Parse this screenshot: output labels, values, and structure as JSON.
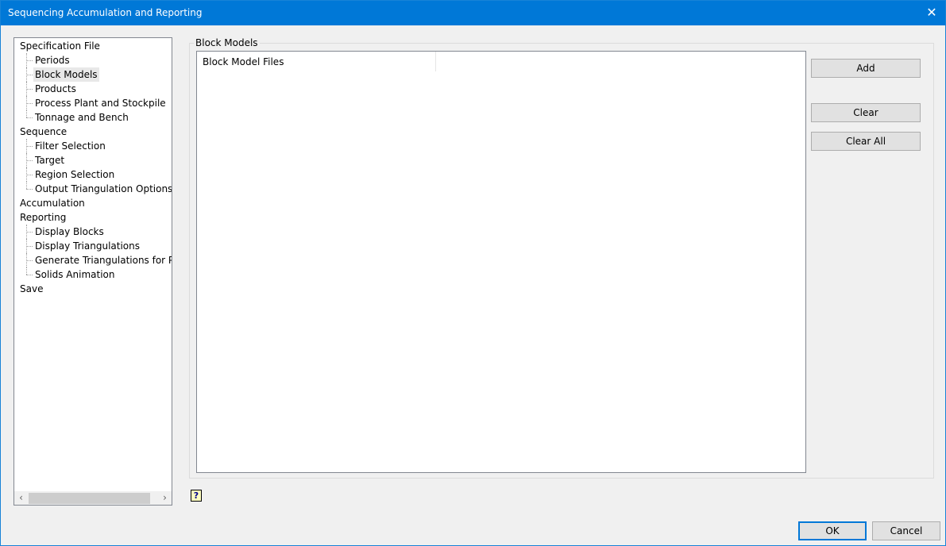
{
  "window": {
    "title": "Sequencing Accumulation and Reporting",
    "close_icon": "close-icon"
  },
  "tree": {
    "nodes": [
      {
        "label": "Specification File",
        "level": 0
      },
      {
        "label": "Periods",
        "level": 1
      },
      {
        "label": "Block Models",
        "level": 1,
        "selected": true
      },
      {
        "label": "Products",
        "level": 1
      },
      {
        "label": "Process Plant and Stockpile",
        "level": 1
      },
      {
        "label": "Tonnage and Bench",
        "level": 1
      },
      {
        "label": "Sequence",
        "level": 0
      },
      {
        "label": "Filter Selection",
        "level": 1
      },
      {
        "label": "Target",
        "level": 1
      },
      {
        "label": "Region Selection",
        "level": 1
      },
      {
        "label": "Output Triangulation Options",
        "level": 1
      },
      {
        "label": "Accumulation",
        "level": 0
      },
      {
        "label": "Reporting",
        "level": 0
      },
      {
        "label": "Display Blocks",
        "level": 1
      },
      {
        "label": "Display Triangulations",
        "level": 1
      },
      {
        "label": "Generate Triangulations for Periods",
        "level": 1
      },
      {
        "label": "Solids Animation",
        "level": 1
      },
      {
        "label": "Save",
        "level": 0
      }
    ]
  },
  "panel": {
    "group_label": "Block Models",
    "column_header": "Block Model Files",
    "add": "Add",
    "clear": "Clear",
    "clear_all": "Clear All"
  },
  "footer": {
    "ok": "OK",
    "cancel": "Cancel",
    "help": "?"
  }
}
